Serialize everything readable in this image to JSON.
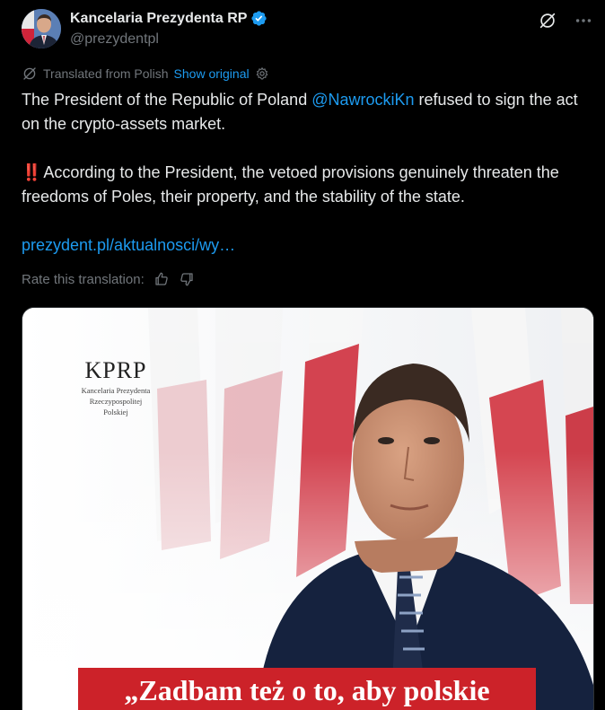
{
  "author": {
    "name": "Kancelaria Prezydenta RP",
    "handle": "@prezydentpl"
  },
  "translation": {
    "label": "Translated from Polish",
    "show_original": "Show original"
  },
  "post": {
    "line1_before": "The President of the Republic of Poland ",
    "mention": "@NawrockiKn",
    "line1_after": " refused to sign the act on the crypto-assets market.",
    "bang": "‼️",
    "paragraph2": "According to the President, the vetoed provisions genuinely threaten the freedoms of Poles, their property, and the stability of the state.",
    "link": "prezydent.pl/aktualnosci/wy…"
  },
  "rate": {
    "label": "Rate this translation:"
  },
  "media": {
    "logo_mark": "KPRP",
    "logo_line1": "Kancelaria Prezydenta",
    "logo_line2": "Rzeczypospolitej",
    "logo_line3": "Polskiej",
    "quote": "„Zadbam też o to, aby polskie"
  },
  "icons": {
    "verified": "verified-badge-icon",
    "grok": "grok-icon",
    "more": "more-icon",
    "translate": "translate-icon",
    "settings": "settings-icon",
    "thumbs_up": "thumbs-up-icon",
    "thumbs_down": "thumbs-down-icon"
  },
  "colors": {
    "background": "#000000",
    "text": "#e7e9ea",
    "secondary": "#71767b",
    "link": "#1d9bf0",
    "banner_red": "#cc2229"
  }
}
